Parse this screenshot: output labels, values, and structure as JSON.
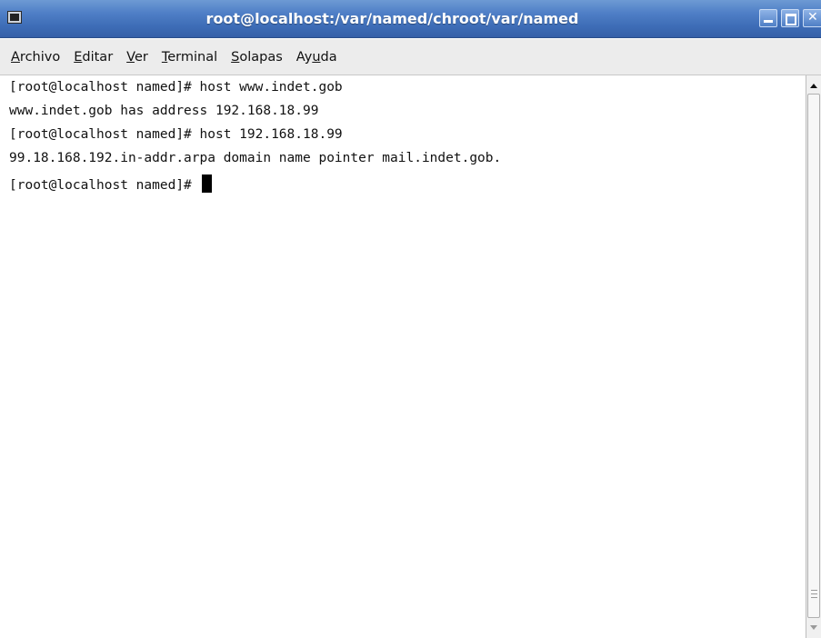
{
  "window": {
    "title": "root@localhost:/var/named/chroot/var/named",
    "icon": "terminal-icon"
  },
  "menu": {
    "items": [
      {
        "label": "Archivo",
        "mnemonic_index": 0
      },
      {
        "label": "Editar",
        "mnemonic_index": 0
      },
      {
        "label": "Ver",
        "mnemonic_index": 0
      },
      {
        "label": "Terminal",
        "mnemonic_index": 0
      },
      {
        "label": "Solapas",
        "mnemonic_index": 0
      },
      {
        "label": "Ayuda",
        "mnemonic_index": 2
      }
    ]
  },
  "terminal": {
    "lines": [
      "[root@localhost named]# host www.indet.gob",
      "www.indet.gob has address 192.168.18.99",
      "[root@localhost named]# host 192.168.18.99",
      "99.18.168.192.in-addr.arpa domain name pointer mail.indet.gob.",
      "[root@localhost named]# "
    ]
  },
  "colors": {
    "titlebar": "#4f7fc6",
    "menubar": "#ececec",
    "terminal_bg": "#ffffff",
    "terminal_fg": "#111111"
  }
}
